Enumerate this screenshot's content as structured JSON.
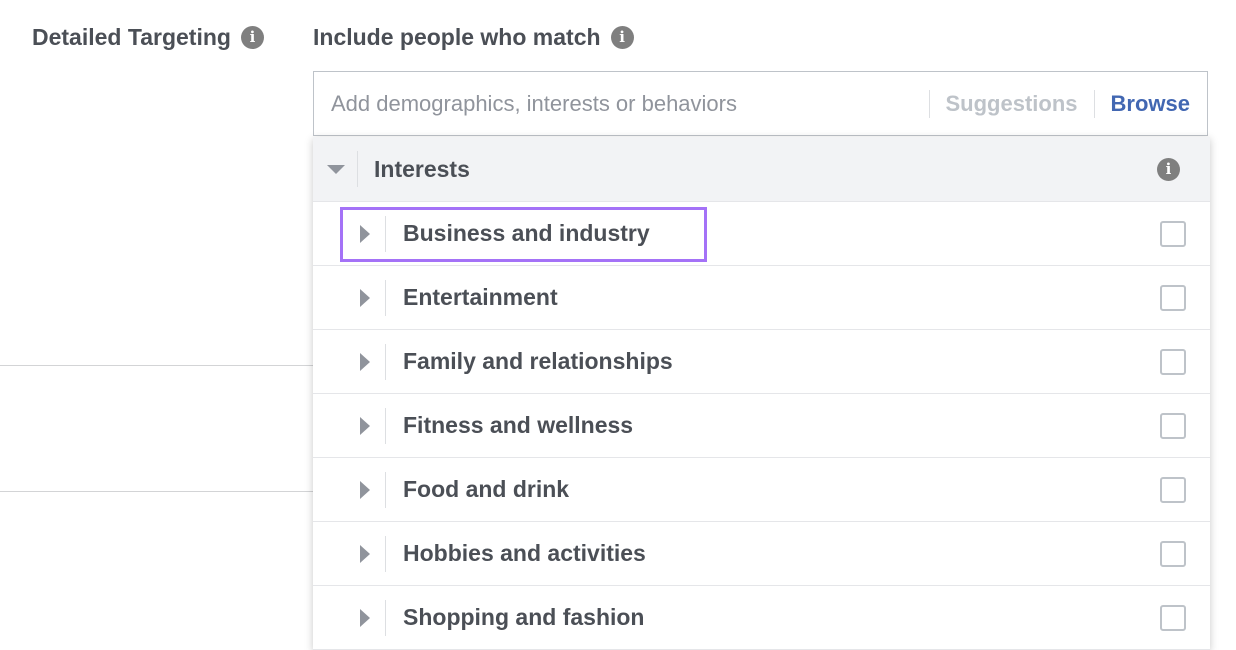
{
  "labels": {
    "detailed_targeting": "Detailed Targeting",
    "include_people": "Include people who match"
  },
  "search": {
    "value": "",
    "placeholder": "Add demographics, interests or behaviors",
    "suggestions_label": "Suggestions",
    "browse_label": "Browse"
  },
  "dropdown": {
    "category": "Interests",
    "category_expanded": true,
    "highlighted_item_index": 0,
    "highlight_color": "#a472f7",
    "items": [
      {
        "label": "Business and industry",
        "checked": false
      },
      {
        "label": "Entertainment",
        "checked": false
      },
      {
        "label": "Family and relationships",
        "checked": false
      },
      {
        "label": "Fitness and wellness",
        "checked": false
      },
      {
        "label": "Food and drink",
        "checked": false
      },
      {
        "label": "Hobbies and activities",
        "checked": false
      },
      {
        "label": "Shopping and fashion",
        "checked": false
      }
    ]
  },
  "icons": {
    "info": "info-icon",
    "expand": "triangle-right-icon",
    "collapse": "triangle-down-icon"
  },
  "colors": {
    "link_blue": "#4267b2",
    "text": "#4b4f56",
    "muted": "#bec3c9"
  }
}
